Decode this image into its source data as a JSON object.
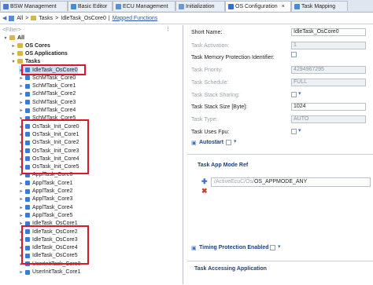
{
  "tabs": [
    {
      "label": "BSW Management",
      "color": "#4a7bd0"
    },
    {
      "label": "Basic Editor",
      "color": "#3f8ddd"
    },
    {
      "label": "ECU Management",
      "color": "#5b8ed8"
    },
    {
      "label": "Initialization",
      "color": "#6a9ad6"
    },
    {
      "label": "OS Configuration",
      "color": "#2f6fcf"
    },
    {
      "label": "Task Mapping",
      "color": "#4a8ad4"
    }
  ],
  "breadcrumb": {
    "items": [
      "All",
      "Tasks",
      "IdleTask_OsCore0"
    ],
    "link": "Mapped Functions"
  },
  "tree": {
    "filter_placeholder": "<Filter>",
    "root": "All",
    "groups": [
      "OS Cores",
      "OS Applications",
      "Tasks"
    ],
    "tasks": [
      "IdleTask_OsCore0",
      "SchMTask_Core0",
      "SchMTask_Core1",
      "SchMTask_Core2",
      "SchMTask_Core3",
      "SchMTask_Core4",
      "SchMTask_Core5",
      "OsTask_Init_Core0",
      "OsTask_Init_Core1",
      "OsTask_Init_Core2",
      "OsTask_Init_Core3",
      "OsTask_Init_Core4",
      "OsTask_Init_Core5",
      "ApplTask_Core0",
      "ApplTask_Core1",
      "ApplTask_Core2",
      "ApplTask_Core3",
      "ApplTask_Core4",
      "ApplTask_Core5",
      "IdleTask_OsCore1",
      "IdleTask_OsCore2",
      "IdleTask_OsCore3",
      "IdleTask_OsCore4",
      "IdleTask_OsCore5",
      "UserInitTask_Core0",
      "UserInitTask_Core1"
    ]
  },
  "props": {
    "short_name_label": "Short Name:",
    "short_name": "IdleTask_OsCore0",
    "task_activation_label": "Task Activation:",
    "task_activation": "1",
    "mem_prot_label": "Task Memory Protection Identifier:",
    "priority_label": "Task Priority:",
    "priority": "4294967295",
    "schedule_label": "Task Schedule:",
    "schedule": "FULL",
    "stack_sharing_label": "Task Stack Sharing:",
    "stack_size_label": "Task Stack Size [Byte]:",
    "stack_size": "1024",
    "task_type_label": "Task Type:",
    "task_type": "AUTO",
    "uses_fpu_label": "Task Uses Fpu:",
    "autostart_label": "Autostart",
    "app_mode_title": "Task App Mode Ref",
    "app_mode_path": "/ActiveEcuC/Os/",
    "app_mode_value": "OS_APPMODE_ANY",
    "timing_label": "Timing Protection Enabled",
    "access_title": "Task Accessing Application"
  }
}
